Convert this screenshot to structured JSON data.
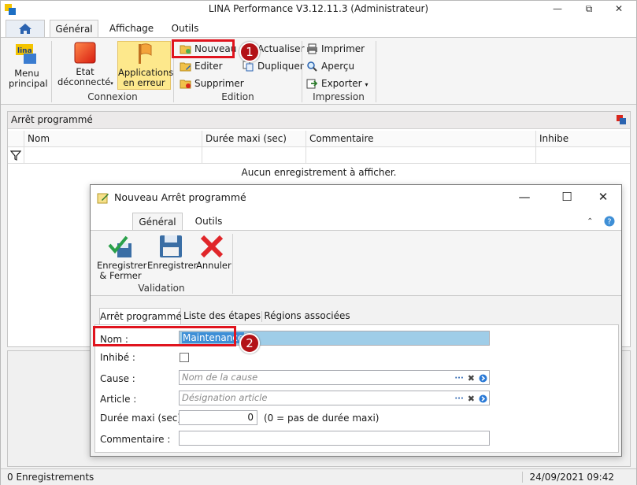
{
  "window": {
    "title": "LINA Performance  V3.12.11.3  (Administrateur)",
    "controls": {
      "minimize": "—",
      "restore": "⧉",
      "close": "✕"
    }
  },
  "ribbon": {
    "tabs": [
      "Général",
      "Affichage",
      "Outils"
    ],
    "groups": {
      "menu": {
        "button": "Menu\nprincipal"
      },
      "connexion": {
        "label": "Connexion",
        "etat": "Etat\ndéconnecté",
        "apps": "Applications\nen erreur"
      },
      "edition": {
        "label": "Edition",
        "nouveau": "Nouveau",
        "editer": "Editer",
        "supprimer": "Supprimer",
        "actualiser": "Actualiser",
        "dupliquer": "Dupliquer"
      },
      "impression": {
        "label": "Impression",
        "imprimer": "Imprimer",
        "apercu": "Aperçu",
        "exporter": "Exporter"
      }
    }
  },
  "grid": {
    "title": "Arrêt programmé",
    "columns": [
      "Nom",
      "Durée maxi (sec)",
      "Commentaire",
      "Inhibe"
    ],
    "empty_message": "Aucun enregistrement à afficher."
  },
  "status": {
    "records": "0 Enregistrements",
    "datetime": "24/09/2021 09:42"
  },
  "dialog": {
    "title": "Nouveau Arrêt programmé",
    "tabs": [
      "Général",
      "Outils"
    ],
    "ribbon": {
      "enregistrer_fermer": "Enregistrer\n& Fermer",
      "enregistrer": "Enregistrer",
      "annuler": "Annuler",
      "group_label": "Validation"
    },
    "subtabs": [
      "Arrêt programmé",
      "Liste des étapes",
      "Régions associées"
    ],
    "form": {
      "nom_label": "Nom :",
      "nom_value": "Maintenance",
      "inhibe_label": "Inhibé :",
      "cause_label": "Cause :",
      "cause_placeholder": "Nom de la cause",
      "article_label": "Article :",
      "article_placeholder": "Désignation article",
      "duree_label": "Durée maxi (sec) :",
      "duree_value": "0",
      "duree_note": "(0 = pas de durée maxi)",
      "commentaire_label": "Commentaire :"
    }
  },
  "callouts": [
    "1",
    "2"
  ],
  "colors": {
    "accent_red": "#e0141e",
    "badge_red": "#b31217",
    "highlight_yellow": "#fde88c",
    "selection_blue": "#9fcde8"
  }
}
